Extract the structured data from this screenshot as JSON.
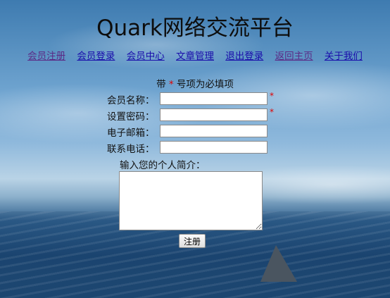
{
  "header": {
    "title": "Quark网络交流平台"
  },
  "nav": {
    "items": [
      {
        "label": "会员注册"
      },
      {
        "label": "会员登录"
      },
      {
        "label": "会员中心"
      },
      {
        "label": "文章管理"
      },
      {
        "label": "退出登录"
      },
      {
        "label": "返回主页"
      },
      {
        "label": "关于我们"
      }
    ]
  },
  "form": {
    "note_prefix": "带",
    "note_star": "*",
    "note_suffix": "号项为必填项",
    "fields": [
      {
        "label": "会员名称：",
        "value": "",
        "required": true,
        "star": "*"
      },
      {
        "label": "设置密码：",
        "value": "",
        "required": true,
        "star": "*"
      },
      {
        "label": "电子邮箱：",
        "value": "",
        "required": false
      },
      {
        "label": "联系电话：",
        "value": "",
        "required": false
      }
    ],
    "intro_label": "输入您的个人简介：",
    "intro_value": "",
    "submit_label": "注册"
  }
}
